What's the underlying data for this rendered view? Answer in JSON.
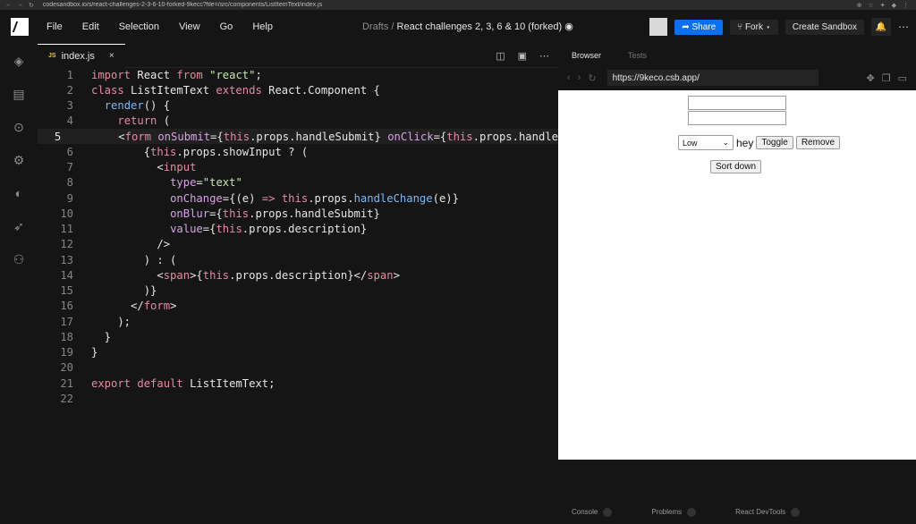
{
  "browser": {
    "url": "codesandbox.io/s/react-challenges-2-3-6-10-forked-9kecc?file=/src/components/ListItemText/index.js"
  },
  "menu": [
    "File",
    "Edit",
    "Selection",
    "View",
    "Go",
    "Help"
  ],
  "breadcrumb": {
    "folder": "Drafts",
    "separator": "/",
    "title": "React challenges 2, 3, 6 & 10 (forked)"
  },
  "toolbar": {
    "share_label": "Share",
    "fork_label": "Fork",
    "create_label": "Create Sandbox"
  },
  "tab": {
    "badge": "JS",
    "label": "index.js",
    "close": "×"
  },
  "preview": {
    "tabs": [
      "Browser",
      "Tests"
    ],
    "url": "https://9keco.csb.app/",
    "select_value": "Low",
    "text": "hey",
    "toggle_label": "Toggle",
    "remove_label": "Remove",
    "sort_label": "Sort down"
  },
  "bottom_tabs": [
    "Console",
    "Problems",
    "React DevTools"
  ],
  "code_lines": [
    "1",
    "2",
    "3",
    "4",
    "5",
    "6",
    "7",
    "8",
    "9",
    "10",
    "11",
    "12",
    "13",
    "14",
    "15",
    "16",
    "17",
    "18",
    "19",
    "20",
    "21",
    "22"
  ],
  "colors": {
    "accent": "#0971f1",
    "keyword": "#e68aa4",
    "string": "#c9e6ad",
    "function": "#7fb7f5"
  }
}
